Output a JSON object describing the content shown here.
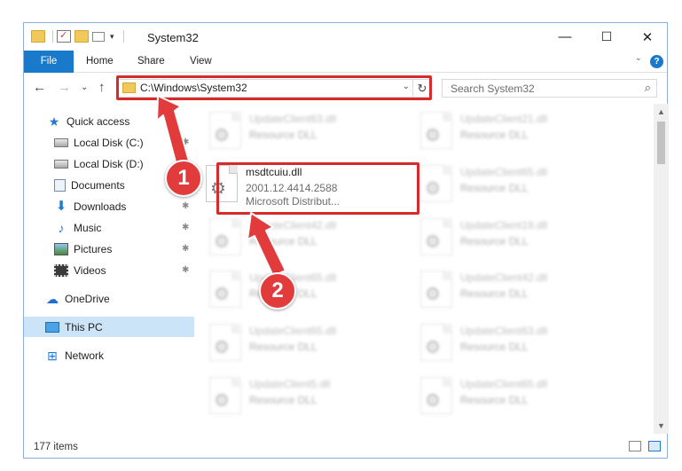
{
  "window": {
    "title": "System32",
    "controls": {
      "minimize": "—",
      "maximize": "☐",
      "close": "✕"
    }
  },
  "ribbon": {
    "tabs": [
      "File",
      "Home",
      "Share",
      "View"
    ],
    "expand": "⌄",
    "help": "?"
  },
  "navigation": {
    "back": "←",
    "forward": "→",
    "recent": "⌄",
    "up": "↑",
    "address": "C:\\Windows\\System32",
    "refresh": "↻",
    "search_placeholder": "Search System32"
  },
  "sidebar": {
    "items": [
      {
        "label": "Quick access",
        "icon": "star-icon",
        "pinned": false
      },
      {
        "label": "Local Disk (C:)",
        "icon": "drive-icon",
        "pinned": true
      },
      {
        "label": "Local Disk (D:)",
        "icon": "drive-icon",
        "pinned": true
      },
      {
        "label": "Documents",
        "icon": "documents-icon",
        "pinned": true
      },
      {
        "label": "Downloads",
        "icon": "downloads-icon",
        "pinned": true
      },
      {
        "label": "Music",
        "icon": "music-icon",
        "pinned": true
      },
      {
        "label": "Pictures",
        "icon": "pictures-icon",
        "pinned": true
      },
      {
        "label": "Videos",
        "icon": "videos-icon",
        "pinned": true
      },
      {
        "label": "OneDrive",
        "icon": "onedrive-icon",
        "pinned": false
      },
      {
        "label": "This PC",
        "icon": "this-pc-icon",
        "pinned": false,
        "selected": true
      },
      {
        "label": "Network",
        "icon": "network-icon",
        "pinned": false
      }
    ]
  },
  "files": {
    "left_column": [
      {
        "name": "UpdateClient63.dll",
        "type": "Resource DLL"
      },
      {
        "name": "msdtcuiu.dll",
        "version": "2001.12.4414.2588",
        "publisher": "Microsoft Distribut...",
        "highlighted": true
      },
      {
        "name": "UpdateClient42.dll",
        "type": "Resource DLL"
      },
      {
        "name": "UpdateClient65.dll",
        "type": "Resource DLL"
      },
      {
        "name": "UpdateClient65.dll",
        "type": "Resource DLL"
      },
      {
        "name": "UpdateClient5.dll",
        "type": "Resource DLL"
      }
    ],
    "right_column": [
      {
        "name": "UpdateClient21.dll",
        "type": "Resource DLL"
      },
      {
        "name": "UpdateClient65.dll",
        "type": "Resource DLL"
      },
      {
        "name": "UpdateClient19.dll",
        "type": "Resource DLL"
      },
      {
        "name": "UpdateClient42.dll",
        "type": "Resource DLL"
      },
      {
        "name": "UpdateClient63.dll",
        "type": "Resource DLL"
      },
      {
        "name": "UpdateClient65.dll",
        "type": "Resource DLL"
      }
    ]
  },
  "status": {
    "item_count": "177 items"
  },
  "annotations": {
    "step1": "1",
    "step2": "2",
    "color": "#d72b2b"
  }
}
